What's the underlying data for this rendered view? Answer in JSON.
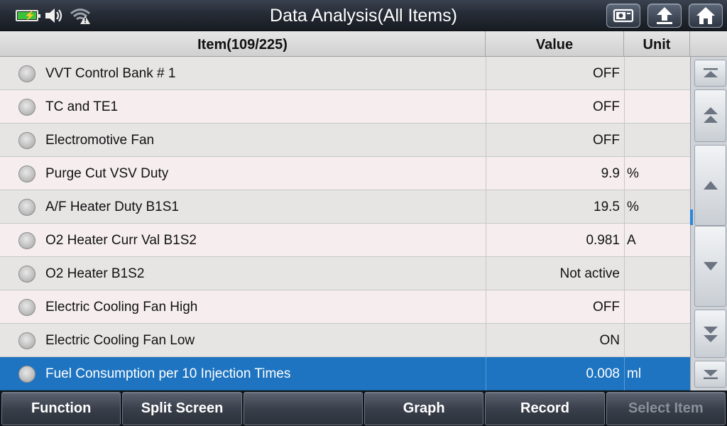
{
  "header": {
    "title": "Data Analysis(All Items)"
  },
  "table": {
    "columns": {
      "item": "Item(109/225)",
      "value": "Value",
      "unit": "Unit"
    },
    "rows": [
      {
        "name": "VVT Control Bank # 1",
        "value": "OFF",
        "unit": ""
      },
      {
        "name": "TC and TE1",
        "value": "OFF",
        "unit": ""
      },
      {
        "name": "Electromotive Fan",
        "value": "OFF",
        "unit": ""
      },
      {
        "name": "Purge Cut VSV Duty",
        "value": "9.9",
        "unit": "%"
      },
      {
        "name": "A/F Heater Duty B1S1",
        "value": "19.5",
        "unit": "%"
      },
      {
        "name": "O2 Heater Curr Val B1S2",
        "value": "0.981",
        "unit": "A"
      },
      {
        "name": "O2 Heater B1S2",
        "value": "Not active",
        "unit": ""
      },
      {
        "name": "Electric Cooling Fan High",
        "value": "OFF",
        "unit": ""
      },
      {
        "name": "Electric Cooling Fan Low",
        "value": "ON",
        "unit": ""
      },
      {
        "name": "Fuel Consumption per 10 Injection Times",
        "value": "0.008",
        "unit": "ml"
      }
    ],
    "selected_index": 9,
    "scroll_position": 0.48
  },
  "footer": {
    "buttons": [
      {
        "label": "Function",
        "enabled": true
      },
      {
        "label": "Split Screen",
        "enabled": true
      },
      {
        "label": "",
        "enabled": true
      },
      {
        "label": "Graph",
        "enabled": true
      },
      {
        "label": "Record",
        "enabled": true
      },
      {
        "label": "Select Item",
        "enabled": false
      }
    ]
  },
  "colors": {
    "selected_row": "#1e74c0",
    "battery": "#3cc13c",
    "scroll_indicator": "#2a86d9"
  },
  "icons": {
    "status": [
      "battery-charging-icon",
      "speaker-icon",
      "wifi-warning-icon"
    ],
    "top_buttons": [
      "screenshot-icon",
      "back-icon",
      "home-icon"
    ],
    "scroll": [
      "scroll-top-icon",
      "page-up-icon",
      "line-up-icon",
      "line-down-icon",
      "page-down-icon",
      "scroll-bottom-icon"
    ]
  }
}
